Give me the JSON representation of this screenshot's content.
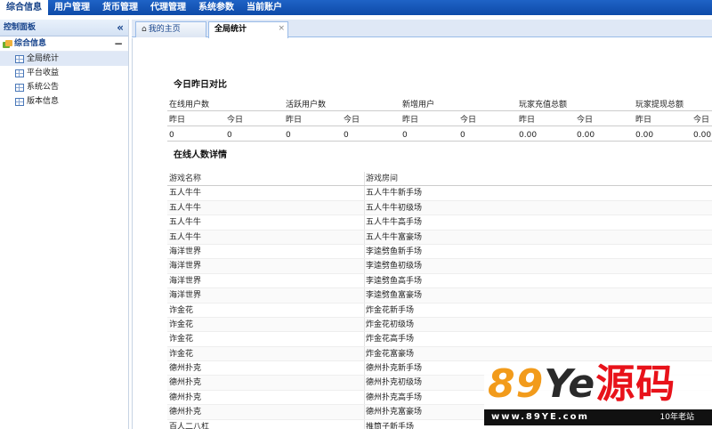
{
  "topnav": {
    "items": [
      "综合信息",
      "用户管理",
      "货币管理",
      "代理管理",
      "系统参数",
      "当前账户"
    ]
  },
  "sidebar": {
    "title": "控制面板",
    "collapse_icon": "«",
    "group": "综合信息",
    "group_toggle": "−",
    "items": [
      "全局统计",
      "平台收益",
      "系统公告",
      "版本信息"
    ]
  },
  "tabs": {
    "home": "我的主页",
    "current": "全局统计",
    "close": "×"
  },
  "compare": {
    "title": "今日昨日对比",
    "headers": [
      "在线用户数",
      "活跃用户数",
      "新增用户",
      "玩家充值总额",
      "玩家提现总额"
    ],
    "sub": [
      "昨日",
      "今日",
      "昨日",
      "今日",
      "昨日",
      "今日",
      "昨日",
      "今日",
      "昨日",
      "今日"
    ],
    "values": [
      "0",
      "0",
      "0",
      "0",
      "0",
      "0",
      "0.00",
      "0.00",
      "0.00",
      "0.00"
    ]
  },
  "online": {
    "title": "在线人数详情",
    "columns": [
      "游戏名称",
      "游戏房间"
    ],
    "rows": [
      [
        "五人牛牛",
        "五人牛牛新手场"
      ],
      [
        "五人牛牛",
        "五人牛牛初级场"
      ],
      [
        "五人牛牛",
        "五人牛牛高手场"
      ],
      [
        "五人牛牛",
        "五人牛牛富豪场"
      ],
      [
        "海洋世界",
        "李逵劈鱼新手场"
      ],
      [
        "海洋世界",
        "李逵劈鱼初级场"
      ],
      [
        "海洋世界",
        "李逵劈鱼高手场"
      ],
      [
        "海洋世界",
        "李逵劈鱼富豪场"
      ],
      [
        "诈金花",
        "炸金花新手场"
      ],
      [
        "诈金花",
        "炸金花初级场"
      ],
      [
        "诈金花",
        "炸金花高手场"
      ],
      [
        "诈金花",
        "炸金花富豪场"
      ],
      [
        "德州扑克",
        "德州扑克新手场"
      ],
      [
        "德州扑克",
        "德州扑克初级场"
      ],
      [
        "德州扑克",
        "德州扑克高手场"
      ],
      [
        "德州扑克",
        "德州扑克富豪场"
      ],
      [
        "百人二八杠",
        "推筒子新手场"
      ]
    ]
  },
  "watermark": {
    "brand_89": "89",
    "brand_ye": "Ye",
    "brand_src": "源码",
    "url": "www.89YE.com",
    "tag": "10年老站"
  }
}
